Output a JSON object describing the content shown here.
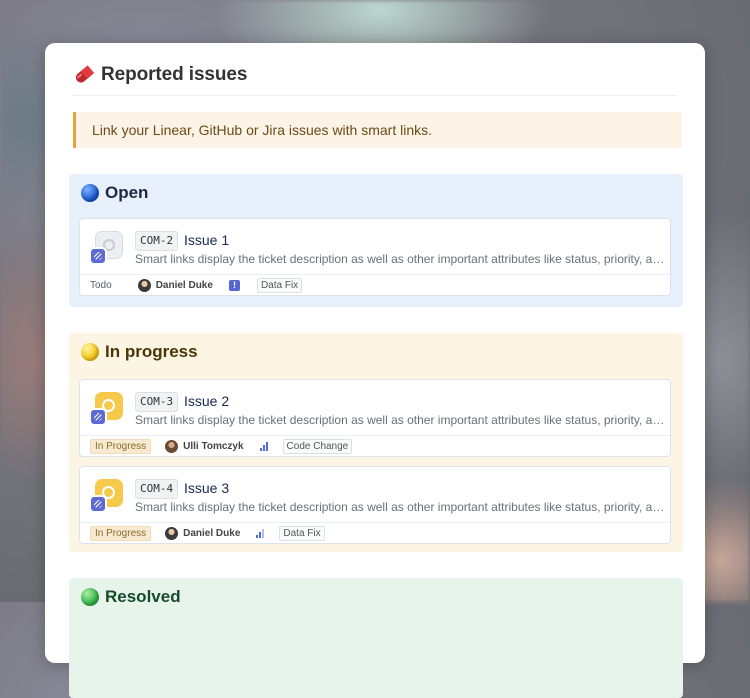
{
  "page": {
    "title": "Reported issues",
    "title_emoji": "pill-icon",
    "callout": "Link your Linear, GitHub or Jira issues with smart links."
  },
  "sections": [
    {
      "title": "Open",
      "color": "#1c5cd0",
      "issues": [
        {
          "key": "COM-2",
          "title": "Issue 1",
          "description": "Smart links display the ticket description as well as other important attributes like status, priority, assi...",
          "status": "Todo",
          "assignee": "Daniel Duke",
          "priority": "urgent",
          "priority_symbol": "!",
          "label": "Data Fix"
        }
      ]
    },
    {
      "title": "In progress",
      "color": "#f5c518",
      "issues": [
        {
          "key": "COM-3",
          "title": "Issue 2",
          "description": "Smart links display the ticket description as well as other important attributes like status, priority, assi...",
          "status": "In Progress",
          "assignee": "Ulli Tomczyk",
          "priority": "high",
          "label": "Code Change"
        },
        {
          "key": "COM-4",
          "title": "Issue 3",
          "description": "Smart links display the ticket description as well as other important attributes like status, priority, assi...",
          "status": "In Progress",
          "assignee": "Daniel Duke",
          "priority": "medium",
          "label": "Data Fix"
        }
      ]
    },
    {
      "title": "Resolved",
      "color": "#36b44a",
      "issues": []
    }
  ],
  "colors": {
    "accent_callout": "#e7a23a",
    "linear_brand": "#5e6ad2"
  }
}
